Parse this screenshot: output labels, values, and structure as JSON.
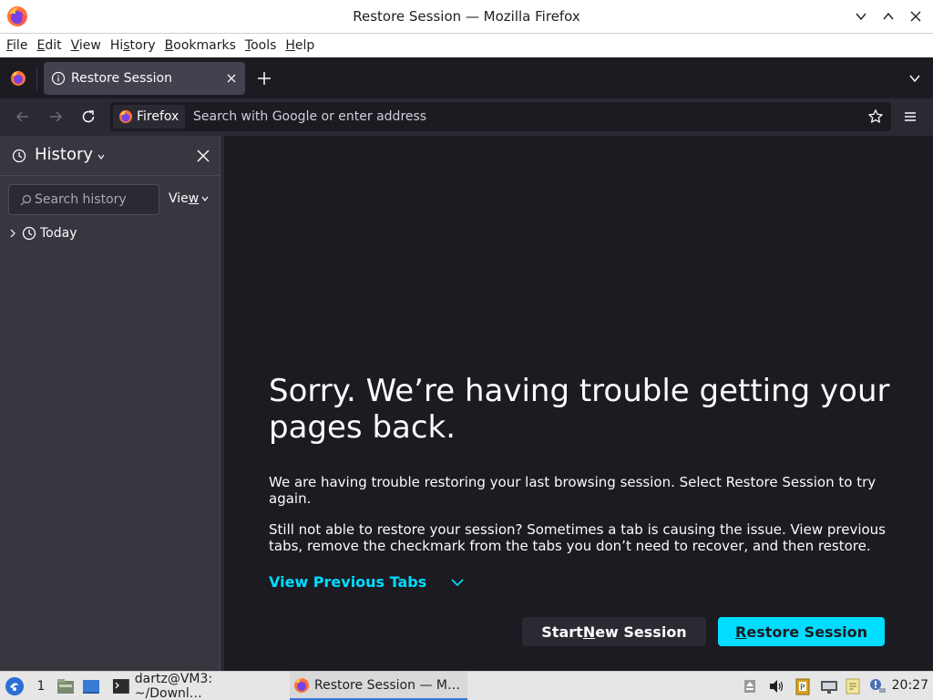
{
  "window": {
    "title": "Restore Session — Mozilla Firefox",
    "buttons": [
      "minimize-chevron-down",
      "maximize-chevron-up",
      "close-x"
    ]
  },
  "menubar": {
    "items": [
      {
        "pre": "",
        "acc": "F",
        "post": "ile"
      },
      {
        "pre": "",
        "acc": "E",
        "post": "dit"
      },
      {
        "pre": "",
        "acc": "V",
        "post": "iew"
      },
      {
        "pre": "Hi",
        "acc": "s",
        "post": "tory"
      },
      {
        "pre": "",
        "acc": "B",
        "post": "ookmarks"
      },
      {
        "pre": "",
        "acc": "T",
        "post": "ools"
      },
      {
        "pre": "",
        "acc": "H",
        "post": "elp"
      }
    ]
  },
  "tabs": {
    "active_label": "Restore Session",
    "icons": [
      "firefox-view-icon",
      "info-icon",
      "close-icon",
      "plus-icon",
      "list-all-tabs-chevron"
    ]
  },
  "navbar": {
    "identity_label": "Firefox",
    "url_placeholder": "Search with Google or enter address"
  },
  "sidebar": {
    "title": "History",
    "search_placeholder": "Search history",
    "view_pre": "Vie",
    "view_acc": "w",
    "tree": [
      {
        "label": "Today",
        "expanded": false
      }
    ]
  },
  "content": {
    "heading": "Sorry. We’re having trouble getting your pages back.",
    "paragraph1": "We are having trouble restoring your last browsing session. Select Restore Session to try again.",
    "paragraph2": "Still not able to restore your session? Sometimes a tab is causing the issue. View previous tabs, remove the checkmark from the tabs you don’t need to recover, and then restore.",
    "view_previous_tabs": "View Previous Tabs",
    "start_new_pre": "Start ",
    "start_new_acc": "N",
    "start_new_post": "ew Session",
    "restore_acc": "R",
    "restore_post": "estore Session",
    "colors": {
      "accent": "#00ddff",
      "background": "#1c1b22"
    }
  },
  "taskbar": {
    "workspace": "1",
    "tasks": [
      {
        "label": "dartz@VM3: ~/Downl…",
        "icon": "terminal-icon",
        "active": false
      },
      {
        "label": "Restore Session — M…",
        "icon": "firefox-icon",
        "active": true
      }
    ],
    "clock": "20:27"
  }
}
